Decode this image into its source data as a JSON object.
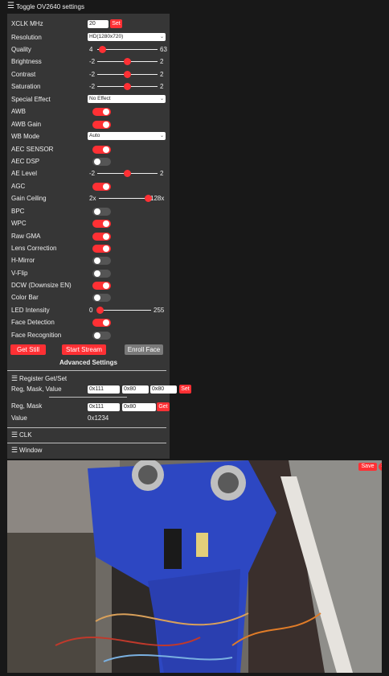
{
  "header": {
    "title": "Toggle OV2640 settings"
  },
  "settings": {
    "xclk": {
      "label": "XCLK MHz",
      "value": "20",
      "button": "Set"
    },
    "resolution": {
      "label": "Resolution",
      "value": "HD(1280x720)"
    },
    "quality": {
      "label": "Quality",
      "min": "4",
      "max": "63",
      "level": 0.08
    },
    "brightness": {
      "label": "Brightness",
      "min": "-2",
      "max": "2",
      "level": 0.5
    },
    "contrast": {
      "label": "Contrast",
      "min": "-2",
      "max": "2",
      "level": 0.5
    },
    "saturation": {
      "label": "Saturation",
      "min": "-2",
      "max": "2",
      "level": 0.5
    },
    "special_effect": {
      "label": "Special Effect",
      "value": "No Effect"
    },
    "awb": {
      "label": "AWB",
      "on": true
    },
    "awb_gain": {
      "label": "AWB Gain",
      "on": true
    },
    "wb_mode": {
      "label": "WB Mode",
      "value": "Auto"
    },
    "aec_sensor": {
      "label": "AEC SENSOR",
      "on": true
    },
    "aec_dsp": {
      "label": "AEC DSP",
      "on": false
    },
    "ae_level": {
      "label": "AE Level",
      "min": "-2",
      "max": "2",
      "level": 0.5
    },
    "agc": {
      "label": "AGC",
      "on": true
    },
    "gain_ceiling": {
      "label": "Gain Ceiling",
      "min": "2x",
      "max": "128x",
      "level": 1.0
    },
    "bpc": {
      "label": "BPC",
      "on": false
    },
    "wpc": {
      "label": "WPC",
      "on": true
    },
    "raw_gma": {
      "label": "Raw GMA",
      "on": true
    },
    "lens_correction": {
      "label": "Lens Correction",
      "on": true
    },
    "h_mirror": {
      "label": "H-Mirror",
      "on": false
    },
    "v_flip": {
      "label": "V-Flip",
      "on": false
    },
    "dcw": {
      "label": "DCW (Downsize EN)",
      "on": true
    },
    "color_bar": {
      "label": "Color Bar",
      "on": false
    },
    "led_intensity": {
      "label": "LED Intensity",
      "min": "0",
      "max": "255",
      "level": 0.05
    },
    "face_detection": {
      "label": "Face Detection",
      "on": true
    },
    "face_recognition": {
      "label": "Face Recognition",
      "on": false
    }
  },
  "actions": {
    "get_still": "Get Still",
    "start_stream": "Start Stream",
    "enroll_face": "Enroll Face"
  },
  "advanced": {
    "title": "Advanced Settings",
    "register_section": "Register Get/Set",
    "reg_set": {
      "label": "Reg, Mask, Value",
      "reg": "0x111",
      "mask": "0x80",
      "value": "0x80",
      "button": "Set"
    },
    "reg_get": {
      "label": "Reg, Mask",
      "reg": "0x111",
      "mask": "0x80",
      "button": "Get"
    },
    "value": {
      "label": "Value",
      "value": "0x1234"
    },
    "clk_section": "CLK",
    "window_section": "Window"
  },
  "viewer": {
    "save": "Save",
    "close": "×"
  },
  "colors": {
    "accent": "#ff3034",
    "panel": "#363636",
    "background": "#181818",
    "toggle_off": "#555555"
  },
  "icons": {
    "menu": "hamburger-icon",
    "dropdown": "chevron-down-icon",
    "close": "close-icon"
  }
}
